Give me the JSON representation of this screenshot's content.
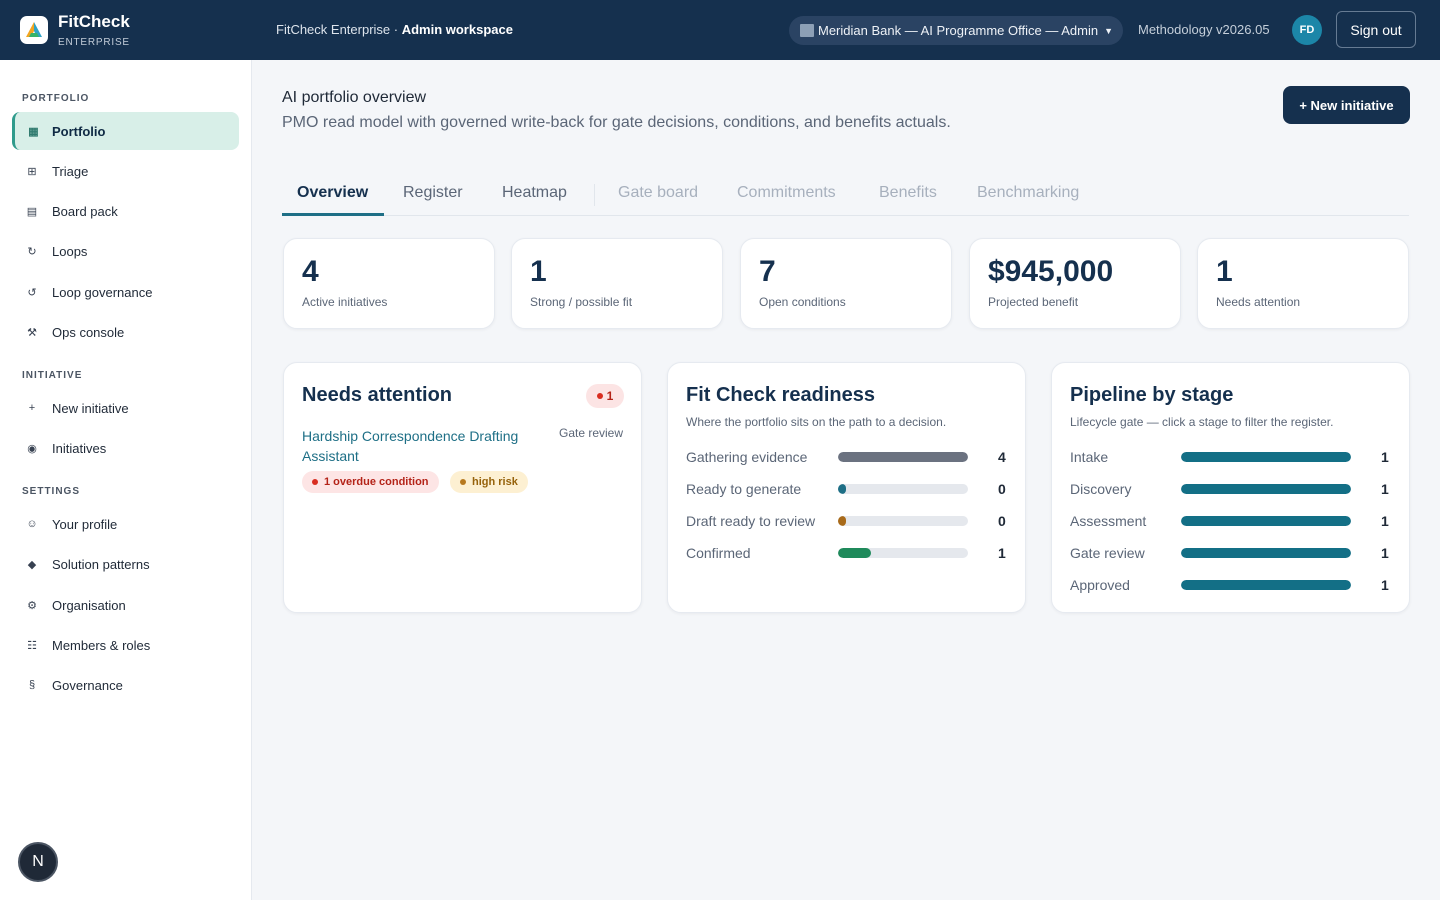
{
  "brand": {
    "name": "FitCheck",
    "edition": "ENTERPRISE"
  },
  "header": {
    "workspace_prefix": "FitCheck Enterprise · ",
    "workspace_name": "Admin workspace",
    "org_selector": "Meridian Bank — AI Programme Office — Admin",
    "methodology": "Methodology v2026.05",
    "avatar_initials": "FD",
    "sign_out": "Sign out"
  },
  "sidebar": {
    "portfolio_title": "PORTFOLIO",
    "portfolio_items": [
      {
        "label": "Portfolio",
        "icon": "grid-icon",
        "glyph": "▦"
      },
      {
        "label": "Triage",
        "icon": "table-icon",
        "glyph": "⊞"
      },
      {
        "label": "Board pack",
        "icon": "document-icon",
        "glyph": "▤"
      },
      {
        "label": "Loops",
        "icon": "loop-icon",
        "glyph": "↻"
      },
      {
        "label": "Loop governance",
        "icon": "loop-governance-icon",
        "glyph": "↺"
      },
      {
        "label": "Ops console",
        "icon": "tools-icon",
        "glyph": "⚒"
      }
    ],
    "initiative_title": "INITIATIVE",
    "initiative_items": [
      {
        "label": "New initiative",
        "icon": "plus-icon",
        "glyph": "+"
      },
      {
        "label": "Initiatives",
        "icon": "target-icon",
        "glyph": "◉"
      }
    ],
    "settings_title": "SETTINGS",
    "settings_items": [
      {
        "label": "Your profile",
        "icon": "smile-icon",
        "glyph": "☺"
      },
      {
        "label": "Solution patterns",
        "icon": "diamond-icon",
        "glyph": "◆"
      },
      {
        "label": "Organisation",
        "icon": "org-icon",
        "glyph": "⚙"
      },
      {
        "label": "Members & roles",
        "icon": "members-icon",
        "glyph": "☷"
      },
      {
        "label": "Governance",
        "icon": "section-icon",
        "glyph": "§"
      }
    ],
    "badge_letter": "N"
  },
  "main": {
    "title": "AI portfolio overview",
    "subtitle": "PMO read model with governed write-back for gate decisions, conditions, and benefits actuals.",
    "new_button": "+ New initiative",
    "tabs": [
      "Overview",
      "Register",
      "Heatmap",
      "Gate board",
      "Commitments",
      "Benefits",
      "Benchmarking"
    ],
    "active_tab": "Overview"
  },
  "kpis": [
    {
      "value": "4",
      "label": "Active initiatives"
    },
    {
      "value": "1",
      "label": "Strong / possible fit"
    },
    {
      "value": "7",
      "label": "Open conditions"
    },
    {
      "value": "$945,000",
      "label": "Projected benefit"
    },
    {
      "value": "1",
      "label": "Needs attention"
    }
  ],
  "needs_attention": {
    "title": "Needs attention",
    "badge_count": "1",
    "item_title": "Hardship Correspondence Drafting Assistant",
    "item_stage": "Gate review",
    "pill_overdue": "1 overdue condition",
    "pill_risk": "high risk"
  },
  "readiness": {
    "title": "Fit Check readiness",
    "subtitle": "Where the portfolio sits on the path to a decision.",
    "rows": [
      {
        "label": "Gathering evidence",
        "value": "4",
        "fraction": 1.0,
        "color": "#6b7280"
      },
      {
        "label": "Ready to generate",
        "value": "0",
        "fraction": 0.05,
        "color": "#1e6f86"
      },
      {
        "label": "Draft ready to review",
        "value": "0",
        "fraction": 0.05,
        "color": "#a86a1a"
      },
      {
        "label": "Confirmed",
        "value": "1",
        "fraction": 0.25,
        "color": "#1f8a5b"
      }
    ]
  },
  "pipeline": {
    "title": "Pipeline by stage",
    "subtitle": "Lifecycle gate — click a stage to filter the register.",
    "rows": [
      {
        "label": "Intake",
        "value": "1",
        "fraction": 1.0
      },
      {
        "label": "Discovery",
        "value": "1",
        "fraction": 1.0
      },
      {
        "label": "Assessment",
        "value": "1",
        "fraction": 1.0
      },
      {
        "label": "Gate review",
        "value": "1",
        "fraction": 1.0
      },
      {
        "label": "Approved",
        "value": "1",
        "fraction": 1.0
      }
    ],
    "bar_color": "#136f86"
  },
  "colors": {
    "navy": "#15304e",
    "teal": "#1e6f86",
    "active_nav_bg": "#d8efe8"
  }
}
